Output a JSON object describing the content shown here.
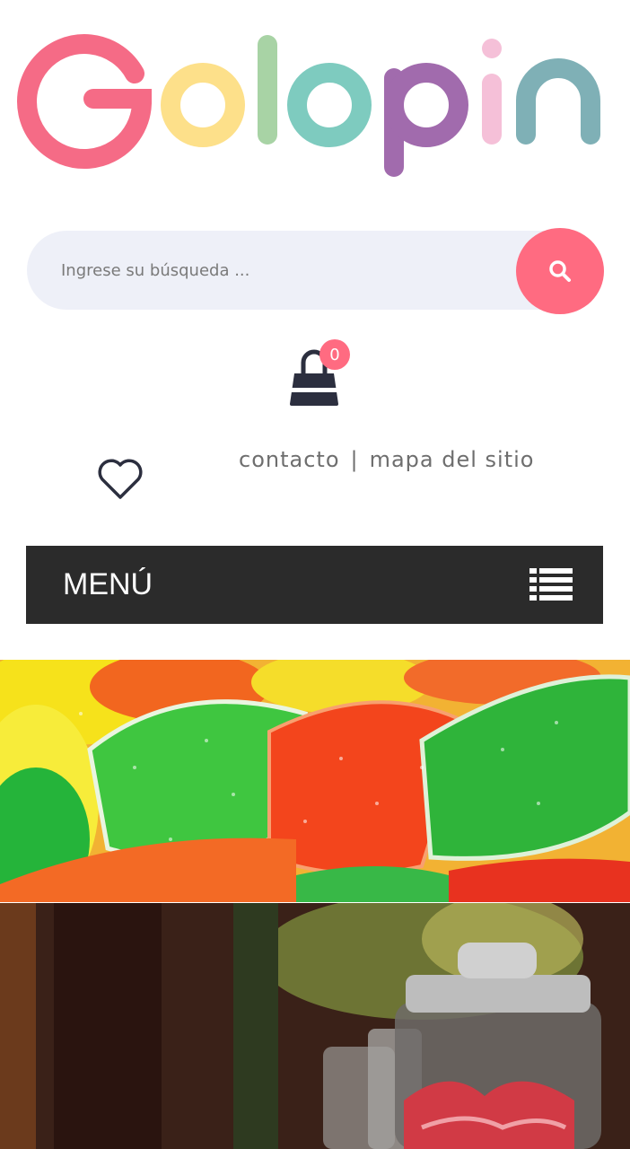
{
  "logo": {
    "letters": [
      "G",
      "o",
      "l",
      "o",
      "p",
      "i",
      "n"
    ],
    "colors": [
      "#f56b86",
      "#fde08a",
      "#a8d3a5",
      "#7ecbbf",
      "#a16bad",
      "#f5c0d8",
      "#7fb0b6"
    ]
  },
  "search": {
    "placeholder": "Ingrese su búsqueda ...",
    "icon": "search-icon",
    "button_color": "#ff6b81"
  },
  "cart": {
    "icon": "shopping-bag-icon",
    "count": "0"
  },
  "wishlist": {
    "icon": "heart-icon"
  },
  "toplinks": {
    "contact": "contacto",
    "separator": "|",
    "sitemap": "mapa del sitio"
  },
  "menu": {
    "label": "MENÚ",
    "icon": "list-icon"
  },
  "colors": {
    "accent": "#ff6b81",
    "menu_bg": "#2b2b2b",
    "search_bg": "#eef0f8"
  }
}
